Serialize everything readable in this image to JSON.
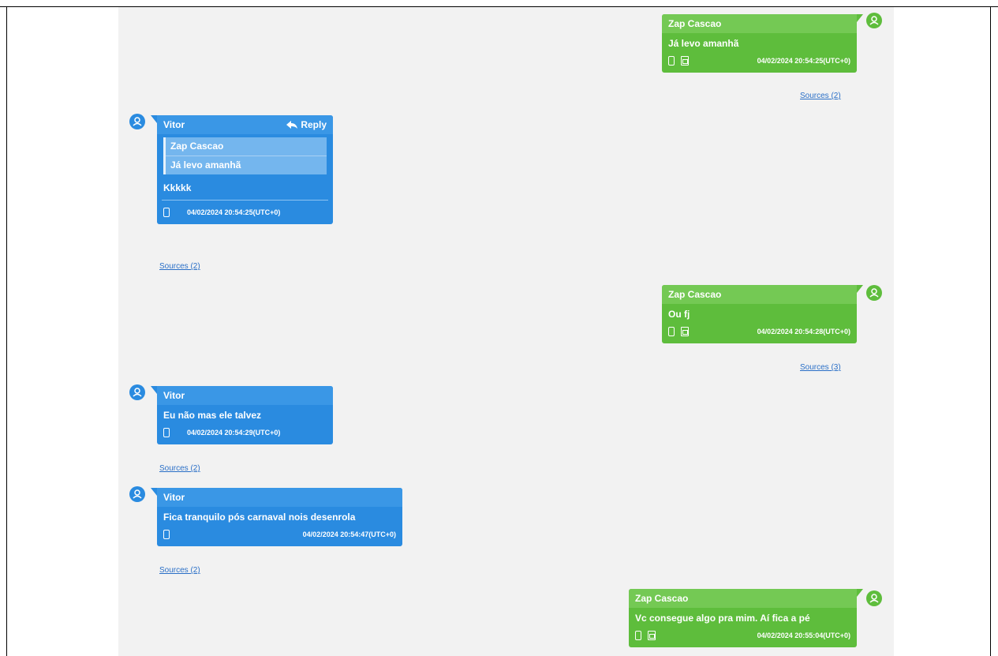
{
  "colors": {
    "incoming": "#2a8be0",
    "outgoing": "#5ebd3c",
    "link": "#2a6fc7",
    "background": "#f2f2f2"
  },
  "icons": {
    "avatar": "user-circle-icon",
    "reply": "reply-arrow-icon",
    "device": "phone-icon",
    "sim": "sim-card-icon"
  },
  "messages": [
    {
      "author": "Zap Cascao",
      "text": "Já levo amanhã",
      "timestamp": "04/02/2024 20:54:25(UTC+0)",
      "sources": "Sources (2)"
    },
    {
      "author": "Vitor",
      "reply_label": "Reply",
      "quote_author": "Zap Cascao",
      "quote_text": "Já levo amanhã",
      "text": "Kkkkk",
      "timestamp": "04/02/2024 20:54:25(UTC+0)",
      "sources": "Sources (2)"
    },
    {
      "author": "Zap Cascao",
      "text": "Ou fj",
      "timestamp": "04/02/2024 20:54:28(UTC+0)",
      "sources": "Sources (3)"
    },
    {
      "author": "Vitor",
      "text": "Eu não mas ele talvez",
      "timestamp": "04/02/2024 20:54:29(UTC+0)",
      "sources": "Sources (2)"
    },
    {
      "author": "Vitor",
      "text": "Fica tranquilo pós carnaval nois desenrola",
      "timestamp": "04/02/2024 20:54:47(UTC+0)",
      "sources": "Sources (2)"
    },
    {
      "author": "Zap Cascao",
      "text": "Vc consegue algo pra mim. Aí fica a pé",
      "timestamp": "04/02/2024 20:55:04(UTC+0)",
      "sources": ""
    }
  ]
}
